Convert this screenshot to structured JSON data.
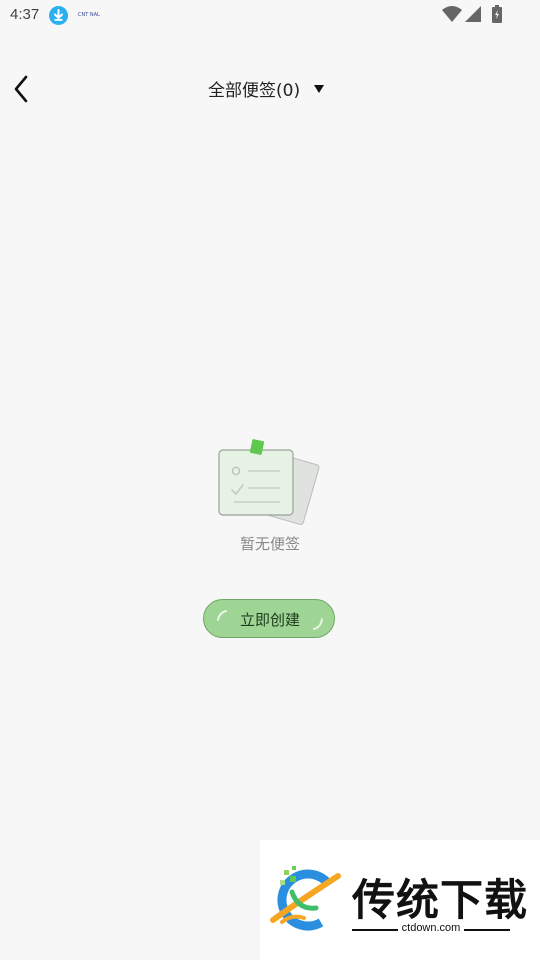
{
  "status_bar": {
    "time": "4:37",
    "download_icon": "download-icon",
    "tiny_logo": "CNT NAL"
  },
  "header": {
    "back_icon": "chevron-left-icon",
    "title": "全部便签(0)",
    "caret_icon": "triangle-down-icon"
  },
  "empty_state": {
    "illustration": "sticky-note-illustration",
    "message": "暂无便签",
    "create_button": "立即创建"
  },
  "watermark": {
    "title": "传统下载",
    "domain": "ctdown.com"
  },
  "colors": {
    "background": "#f7f7f7",
    "button_fill": "#9ed494",
    "button_border": "#6fa866",
    "note_fill": "#e6f2e4",
    "pin_green": "#5ec94e",
    "download_blue": "#2ab0f0"
  }
}
